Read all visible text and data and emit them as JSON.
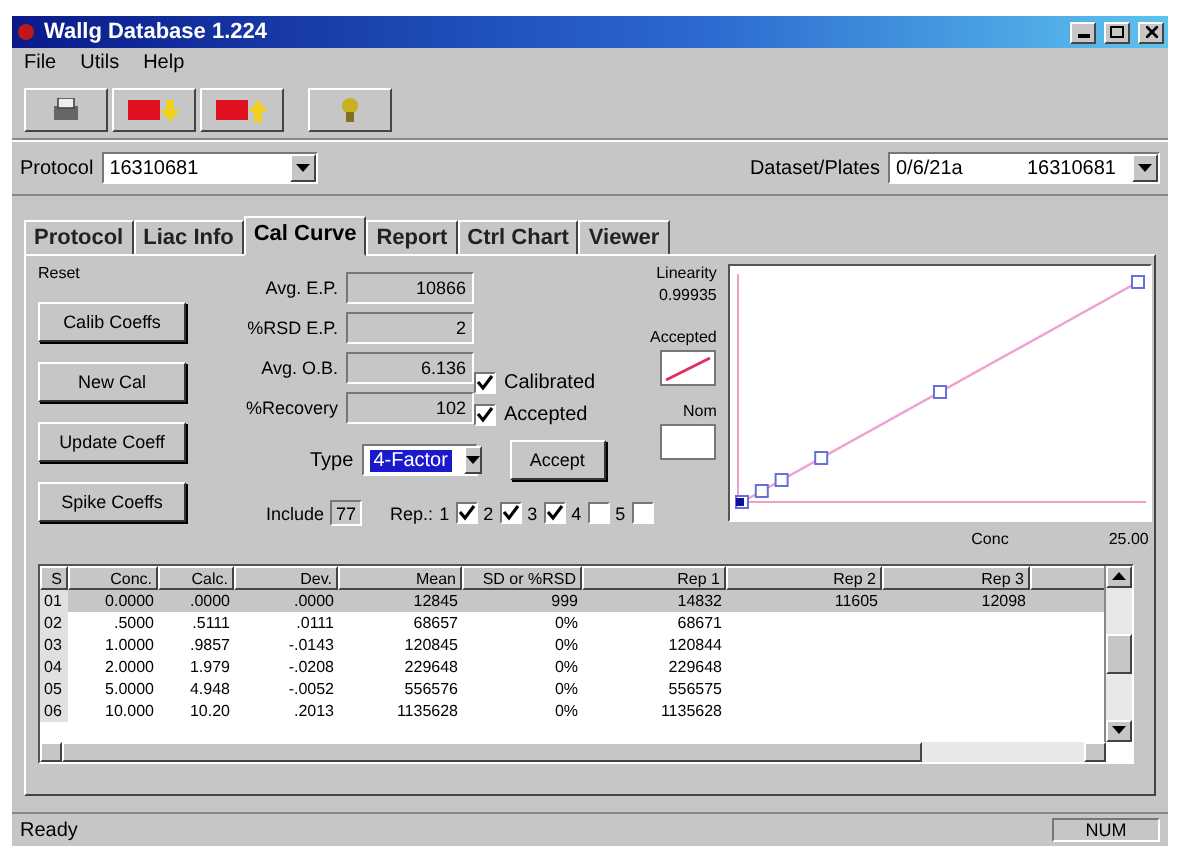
{
  "window": {
    "title": "Wallg Database 1.224"
  },
  "menu": [
    "File",
    "Utils",
    "Help"
  ],
  "protocol_bar": {
    "protocol_label": "Protocol",
    "protocol": "16310681",
    "dataset_label": "Dataset/Plates",
    "dataset": "0/6/21a",
    "plate": "16310681"
  },
  "tabs": [
    {
      "label": "Protocol",
      "selected": false
    },
    {
      "label": "Liac Info",
      "selected": false
    },
    {
      "label": "Cal Curve",
      "selected": true
    },
    {
      "label": "Report",
      "selected": false
    },
    {
      "label": "Ctrl Chart",
      "selected": false
    },
    {
      "label": "Viewer",
      "selected": false
    }
  ],
  "reset": {
    "label": "Reset",
    "buttons": [
      "Calib Coeffs",
      "New Cal",
      "Update Coeff",
      "Spike Coeffs"
    ]
  },
  "fields": [
    {
      "label": "Avg. E.P.",
      "value": "10866"
    },
    {
      "label": "%RSD E.P.",
      "value": "2"
    },
    {
      "label": "Avg. O.B.",
      "value": "6.136"
    },
    {
      "label": "%Recovery",
      "value": "102"
    }
  ],
  "flags": [
    {
      "label": "Calibrated",
      "checked": true
    },
    {
      "label": "Accepted",
      "checked": true
    }
  ],
  "type": {
    "label": "Type",
    "value": "4-Factor"
  },
  "accept_button": "Accept",
  "include": {
    "label": "Include",
    "value": "77",
    "reps_label": "Rep.:",
    "reps": [
      {
        "label": "1",
        "checked": true
      },
      {
        "label": "2",
        "checked": true
      },
      {
        "label": "3",
        "checked": true
      },
      {
        "label": "4",
        "checked": false
      },
      {
        "label": "5",
        "checked": false
      }
    ]
  },
  "legend": {
    "linearity_label": "Linearity",
    "linearity": "0.99935",
    "accepted_label": "Accepted",
    "nom_label": "Nom"
  },
  "chart": {
    "xlabel": "Conc",
    "xmax": "25.00"
  },
  "table": {
    "columns": [
      "S",
      "Conc.",
      "Calc.",
      "Dev.",
      "Mean",
      "SD or %RSD",
      "Rep 1",
      "Rep 2",
      "Rep 3"
    ],
    "rows": [
      {
        "selected": true,
        "cells": [
          "01",
          "0.0000",
          ".0000",
          ".0000",
          "12845",
          "999",
          "14832",
          "11605",
          "12098"
        ]
      },
      {
        "selected": false,
        "cells": [
          "02",
          ".5000",
          ".5111",
          ".0111",
          "68657",
          "0%",
          "68671",
          "",
          ""
        ]
      },
      {
        "selected": false,
        "cells": [
          "03",
          "1.0000",
          ".9857",
          "-.0143",
          "120845",
          "0%",
          "120844",
          "",
          ""
        ]
      },
      {
        "selected": false,
        "cells": [
          "04",
          "2.0000",
          "1.979",
          "-.0208",
          "229648",
          "0%",
          "229648",
          "",
          ""
        ]
      },
      {
        "selected": false,
        "cells": [
          "05",
          "5.0000",
          "4.948",
          "-.0052",
          "556576",
          "0%",
          "556575",
          "",
          ""
        ]
      },
      {
        "selected": false,
        "cells": [
          "06",
          "10.000",
          "10.20",
          ".2013",
          "1135628",
          "0%",
          "1135628",
          "",
          ""
        ]
      }
    ]
  },
  "status_bar": {
    "message": "Ready",
    "num": "NUM"
  }
}
